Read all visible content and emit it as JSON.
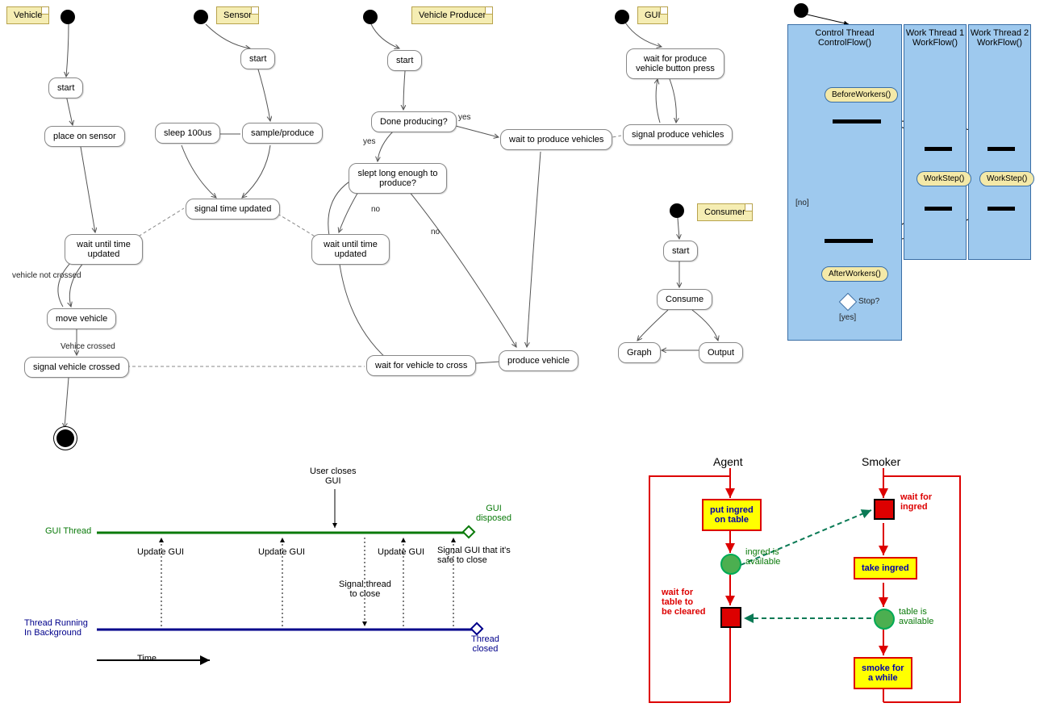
{
  "vehicle": {
    "note": "Vehicle",
    "start": "start",
    "place": "place on sensor",
    "wait_time": "wait until time updated",
    "not_crossed": "vehicle not crossed",
    "move": "move vehicle",
    "crossed": "Vehice crossed",
    "signal_crossed": "signal vehicle crossed"
  },
  "sensor": {
    "note": "Sensor",
    "start": "start",
    "sleep": "sleep 100us",
    "sample": "sample/produce",
    "signal": "signal time updated"
  },
  "producer": {
    "note": "Vehicle Producer",
    "start": "start",
    "done_q": "Done producing?",
    "yes": "yes",
    "slept_q": "slept long enough to produce?",
    "no": "no",
    "wait_time": "wait until time updated",
    "wait_produce": "wait to produce vehicles",
    "wait_cross": "wait for vehicle to cross",
    "produce": "produce vehicle"
  },
  "gui": {
    "note": "GUI",
    "wait_btn": "wait for produce vehicle button press",
    "signal_prod": "signal produce vehicles"
  },
  "consumer": {
    "note": "Consumer",
    "start": "start",
    "consume": "Consume",
    "graph": "Graph",
    "output": "Output"
  },
  "lanes": {
    "control": {
      "title1": "Control Thread",
      "title2": "ControlFlow()",
      "before": "BeforeWorkers()",
      "after": "AfterWorkers()",
      "stop": "Stop?",
      "no": "[no]",
      "yes": "[yes]"
    },
    "w1": {
      "title1": "Work Thread 1",
      "title2": "WorkFlow()",
      "step": "WorkStep()"
    },
    "w2": {
      "title1": "Work Thread 2",
      "title2": "WorkFlow()",
      "step": "WorkStep()"
    }
  },
  "timeline": {
    "gui_thread": "GUI Thread",
    "bg_thread1": "Thread Running",
    "bg_thread2": "In Background",
    "update": "Update GUI",
    "user_closes1": "User closes",
    "user_closes2": "GUI",
    "signal_close1": "Signal thread",
    "signal_close2": "to close",
    "gui_disposed1": "GUI",
    "gui_disposed2": "disposed",
    "safe1": "Signal GUI that it's",
    "safe2": "safe to close",
    "thread_closed1": "Thread",
    "thread_closed2": "closed",
    "time": "Time"
  },
  "agent": {
    "title": "Agent",
    "put1": "put ingred",
    "put2": "on table",
    "avail1": "ingred is",
    "avail2": "available",
    "wait1": "wait for",
    "wait2": "table to",
    "wait3": "be cleared"
  },
  "smoker": {
    "title": "Smoker",
    "wait1": "wait for",
    "wait2": "ingred",
    "take": "take ingred",
    "avail1": "table is",
    "avail2": "available",
    "smoke1": "smoke for",
    "smoke2": "a while"
  }
}
